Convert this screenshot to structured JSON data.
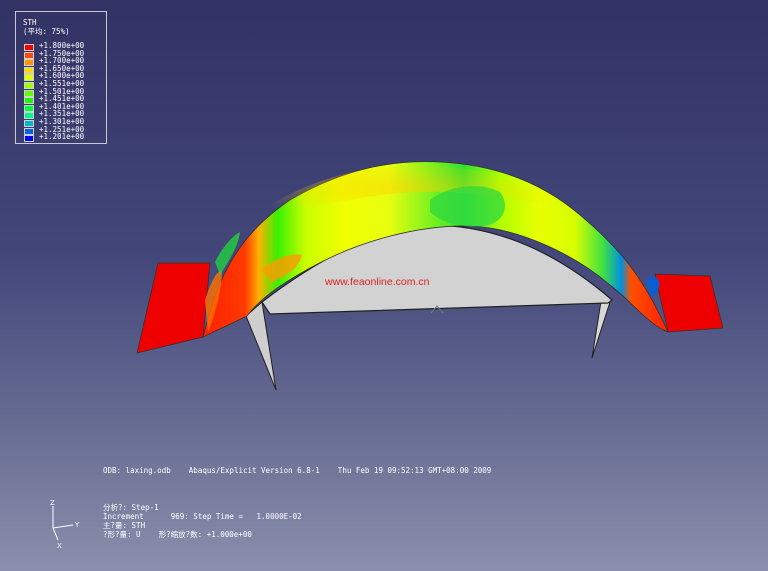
{
  "legend": {
    "title": "STH",
    "subtitle": "(平均: 75%)",
    "entries": [
      {
        "label": "+1.800e+00",
        "color": "#ff0000"
      },
      {
        "label": "+1.750e+00",
        "color": "#ff4a00"
      },
      {
        "label": "+1.700e+00",
        "color": "#ff9400"
      },
      {
        "label": "+1.650e+00",
        "color": "#ffd900"
      },
      {
        "label": "+1.600e+00",
        "color": "#e1ff00"
      },
      {
        "label": "+1.551e+00",
        "color": "#9dff00"
      },
      {
        "label": "+1.501e+00",
        "color": "#5cff00"
      },
      {
        "label": "+1.451e+00",
        "color": "#1aff00"
      },
      {
        "label": "+1.401e+00",
        "color": "#00ff37"
      },
      {
        "label": "+1.351e+00",
        "color": "#00f88f"
      },
      {
        "label": "+1.301e+00",
        "color": "#00b9c8"
      },
      {
        "label": "+1.251e+00",
        "color": "#0066e6"
      },
      {
        "label": "+1.201e+00",
        "color": "#0000ff"
      }
    ]
  },
  "watermark": "www.feaonline.com.cn",
  "odb_line": "ODB: laxing.odb    Abaqus/Explicit Version 6.8-1    Thu Feb 19 09:52:13 GMT+08:00 2009",
  "step_info": {
    "line1": "分析?: Step-1",
    "line2": "Increment      969: Step Time =   1.0000E-02",
    "line3": "主?量: STH",
    "line4": "?形?量: U    形?缩放?数: +1.000e+00"
  },
  "triad": {
    "z": "Z",
    "y": "Y",
    "x": "X"
  },
  "colors": {
    "background_top": "#323264",
    "background_bottom": "#8a8fac",
    "die_surface": "#d3d3d3"
  }
}
